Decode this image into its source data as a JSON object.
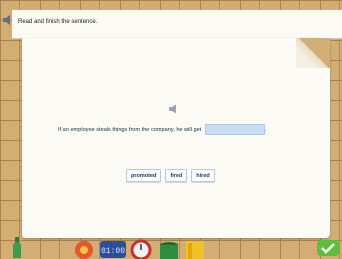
{
  "instruction": "Read and finish the sentence.",
  "sentence": {
    "text": "If an employee steals things from the company, he will get",
    "end": "."
  },
  "options": [
    "promoted",
    "fired",
    "hired"
  ],
  "toolbar": {
    "clock_time": "01:00",
    "icons": [
      "bottle-icon",
      "flower-icon",
      "clock-icon",
      "dial-icon",
      "paint-can-icon",
      "book-icon",
      "check-icon"
    ]
  },
  "colors": {
    "wall": "#d2ad74",
    "paper": "#fbfaf5",
    "blank": "#c9dcf6",
    "check": "#5bbf3c"
  }
}
